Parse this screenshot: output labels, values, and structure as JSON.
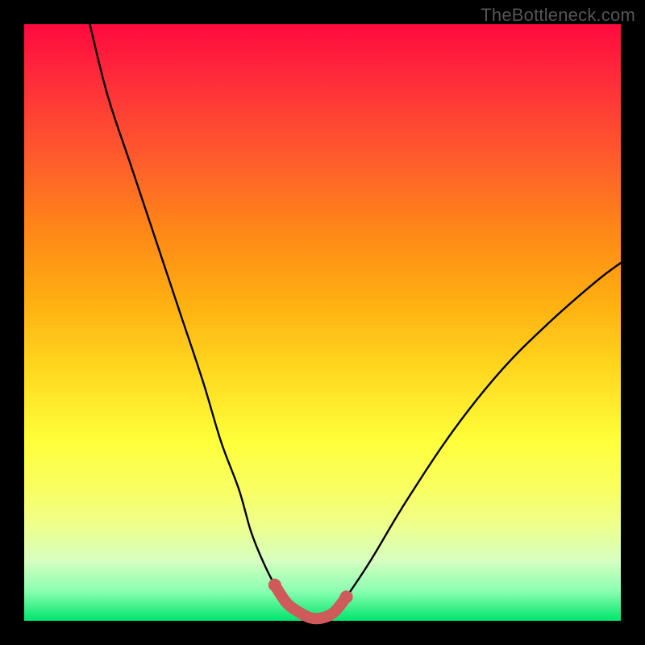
{
  "watermark": "TheBottleneck.com",
  "chart_data": {
    "type": "line",
    "title": "",
    "xlabel": "",
    "ylabel": "",
    "xlim": [
      0,
      100
    ],
    "ylim": [
      0,
      100
    ],
    "series": [
      {
        "name": "bottleneck-curve",
        "x": [
          11,
          14,
          18,
          22,
          26,
          30,
          33,
          36,
          38,
          40,
          42,
          44,
          46,
          48,
          50,
          52,
          54,
          58,
          64,
          72,
          80,
          88,
          96,
          100
        ],
        "values": [
          100,
          88,
          76,
          64,
          52,
          40,
          30,
          22,
          15,
          10,
          6,
          3,
          1.5,
          0.5,
          0.5,
          1.5,
          4,
          10,
          20,
          32,
          42,
          50,
          57,
          60
        ]
      },
      {
        "name": "highlight-segment",
        "x": [
          42,
          44,
          46,
          48,
          50,
          52,
          54
        ],
        "values": [
          6,
          3,
          1.5,
          0.5,
          0.5,
          1.5,
          4
        ]
      }
    ]
  }
}
